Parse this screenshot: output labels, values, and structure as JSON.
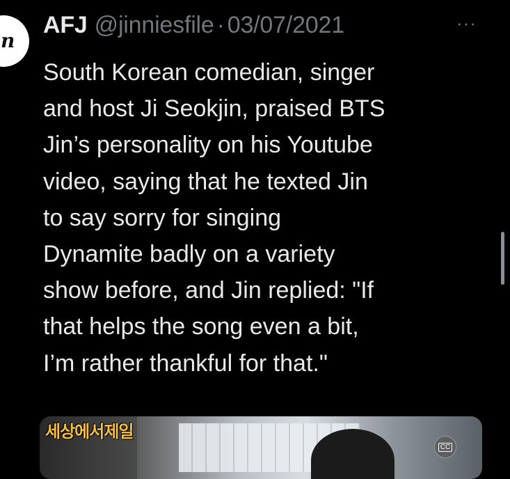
{
  "tweet": {
    "author_name": "AFJ",
    "handle": "@jinniesfile",
    "separator": "·",
    "date": "03/07/2021",
    "more_label": "···",
    "lines": [
      "South Korean comedian, singer",
      "and host Ji Seokjin, praised BTS",
      "Jin’s personality on his Youtube",
      "video, saying that he texted Jin",
      "to say sorry for singing",
      "Dynamite badly on a variety",
      "show before, and Jin replied: \"If",
      "that helps the song even a bit,",
      "I’m rather thankful for that.\""
    ]
  },
  "avatar": {
    "glyph": "n"
  },
  "media": {
    "caption_text": "세상에서제일",
    "cc_label": "CC"
  },
  "colors": {
    "background": "#000000",
    "text": "#e7e9ea",
    "muted": "#71767b"
  }
}
